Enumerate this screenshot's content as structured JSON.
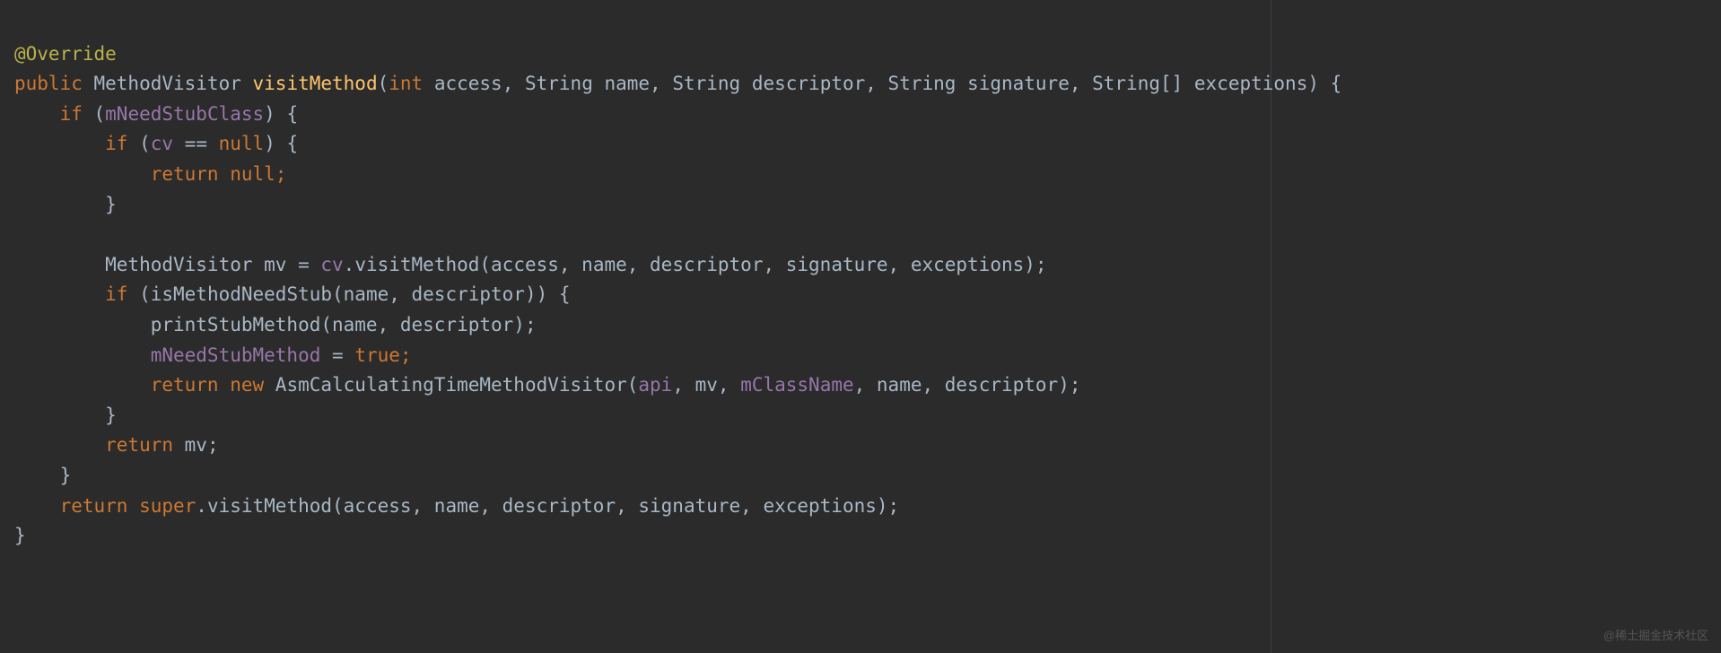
{
  "code": {
    "line1_annotation": "@Override",
    "line2_public": "public",
    "line2_returnType": " MethodVisitor ",
    "line2_methodName": "visitMethod",
    "line2_open": "(",
    "line2_intKw": "int",
    "line2_params": " access, String name, String descriptor, String signature, String[] exceptions) {",
    "line3_if": "    if",
    "line3_open": " (",
    "line3_field": "mNeedStubClass",
    "line3_close": ") {",
    "line4_if": "        if",
    "line4_open": " (",
    "line4_cv": "cv",
    "line4_eq": " == ",
    "line4_null": "null",
    "line4_close": ") {",
    "line5_return": "            return ",
    "line5_null": "null",
    "line5_semi": ";",
    "line6_brace": "        }",
    "line7_empty": "",
    "line8_indent": "        MethodVisitor mv = ",
    "line8_cv": "cv",
    "line8_rest": ".visitMethod(access, name, descriptor, signature, exceptions);",
    "line9_if": "        if",
    "line9_rest": " (isMethodNeedStub(name, descriptor)) {",
    "line10_rest": "            printStubMethod(name, descriptor);",
    "line11_indent": "            ",
    "line11_field": "mNeedStubMethod",
    "line11_eq": " = ",
    "line11_true": "true",
    "line11_semi": ";",
    "line12_return": "            return new",
    "line12_rest": " AsmCalculatingTimeMethodVisitor(",
    "line12_api": "api",
    "line12_c1": ", mv, ",
    "line12_cls": "mClassName",
    "line12_c2": ", name, descriptor);",
    "line13_brace": "        }",
    "line14_return": "        return",
    "line14_rest": " mv;",
    "line15_brace": "    }",
    "line16_return": "    return ",
    "line16_super": "super",
    "line16_rest": ".visitMethod(access, name, descriptor, signature, exceptions);",
    "line17_brace": "}"
  },
  "watermark": "@稀土掘金技术社区"
}
